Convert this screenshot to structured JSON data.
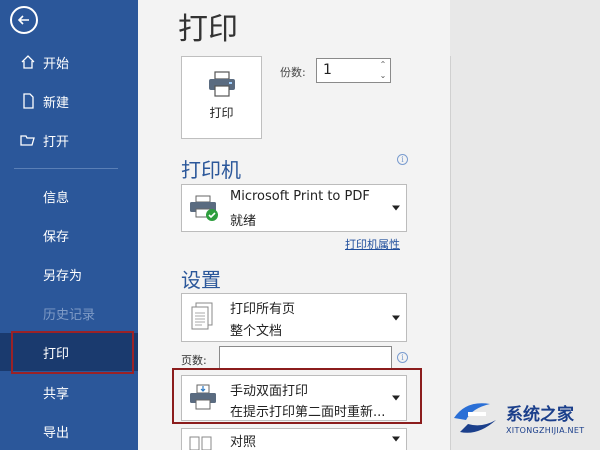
{
  "sidebar": {
    "items": [
      {
        "label": "开始",
        "icon": "home-icon"
      },
      {
        "label": "新建",
        "icon": "new-document-icon"
      },
      {
        "label": "打开",
        "icon": "folder-open-icon"
      },
      {
        "label": "信息"
      },
      {
        "label": "保存"
      },
      {
        "label": "另存为"
      },
      {
        "label": "历史记录"
      },
      {
        "label": "打印"
      },
      {
        "label": "共享"
      },
      {
        "label": "导出"
      }
    ]
  },
  "main": {
    "title": "打印",
    "print_button_label": "打印",
    "copies": {
      "label": "份数:",
      "value": "1"
    },
    "printer": {
      "section_title": "打印机",
      "name": "Microsoft Print to PDF",
      "status": "就绪",
      "properties_link": "打印机属性"
    },
    "settings": {
      "section_title": "设置",
      "pages_select": {
        "main": "打印所有页",
        "sub": "整个文档"
      },
      "pages_label": "页数:",
      "pages_value": "",
      "duplex_select": {
        "main": "手动双面打印",
        "sub": "在提示打印第二面时重新..."
      },
      "collate_select": {
        "main": "对照"
      }
    }
  },
  "watermark": {
    "title": "系统之家",
    "url": "XITONGZHIJIA.NET"
  },
  "colors": {
    "sidebar": "#2b579a",
    "active": "#1a3a6e",
    "outline": "#9b2226",
    "accent": "#2b579a"
  }
}
